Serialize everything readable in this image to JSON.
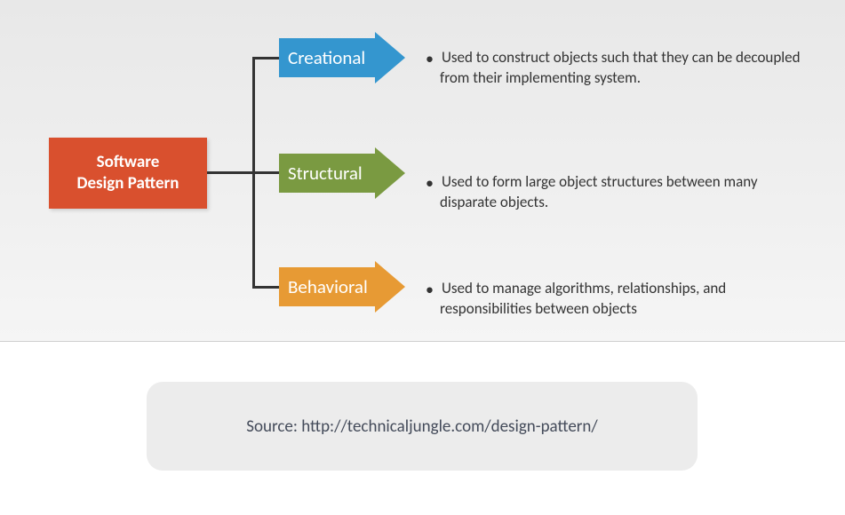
{
  "root": {
    "line1": "Software",
    "line2": "Design Pattern"
  },
  "branches": [
    {
      "label": "Creational",
      "color": "#3496cf",
      "description": "Used to construct objects such that they can be decoupled from their implementing system."
    },
    {
      "label": "Structural",
      "color": "#7a9a41",
      "description": "Used to form large object structures between many disparate objects."
    },
    {
      "label": "Behavioral",
      "color": "#e79a34",
      "description": "Used to manage algorithms, relationships, and responsibilities between objects"
    }
  ],
  "caption": "Source: http://technicaljungle.com/design-pattern/"
}
